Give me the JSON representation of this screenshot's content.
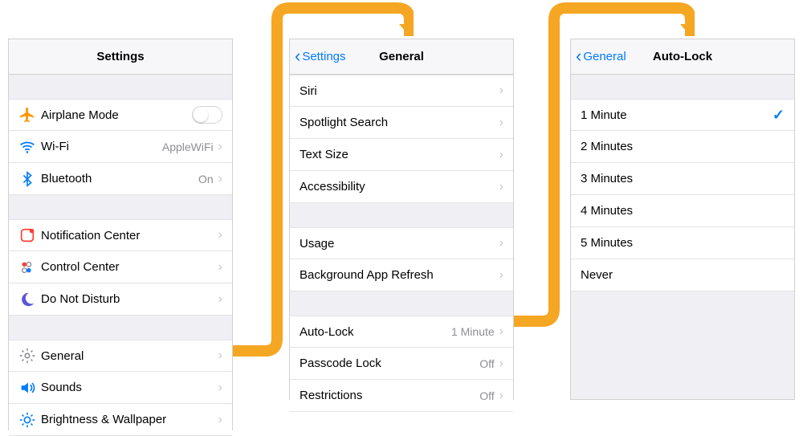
{
  "panel1": {
    "title": "Settings",
    "g1": [
      {
        "label": "Airplane Mode",
        "type": "toggle"
      },
      {
        "label": "Wi-Fi",
        "value": "AppleWiFi",
        "chevron": true
      },
      {
        "label": "Bluetooth",
        "value": "On",
        "chevron": true
      }
    ],
    "g2": [
      {
        "label": "Notification Center",
        "chevron": true
      },
      {
        "label": "Control Center",
        "chevron": true
      },
      {
        "label": "Do Not Disturb",
        "chevron": true
      }
    ],
    "g3": [
      {
        "label": "General",
        "chevron": true
      },
      {
        "label": "Sounds",
        "chevron": true
      },
      {
        "label": "Brightness & Wallpaper",
        "chevron": true
      }
    ]
  },
  "panel2": {
    "back": "Settings",
    "title": "General",
    "g1": [
      {
        "label": "Siri",
        "chevron": true
      },
      {
        "label": "Spotlight Search",
        "chevron": true
      },
      {
        "label": "Text Size",
        "chevron": true
      },
      {
        "label": "Accessibility",
        "chevron": true
      }
    ],
    "g2": [
      {
        "label": "Usage",
        "chevron": true
      },
      {
        "label": "Background App Refresh",
        "chevron": true
      }
    ],
    "g3": [
      {
        "label": "Auto-Lock",
        "value": "1 Minute",
        "chevron": true
      },
      {
        "label": "Passcode Lock",
        "value": "Off",
        "chevron": true
      },
      {
        "label": "Restrictions",
        "value": "Off",
        "chevron": true
      }
    ]
  },
  "panel3": {
    "back": "General",
    "title": "Auto-Lock",
    "options": [
      {
        "label": "1 Minute",
        "selected": true
      },
      {
        "label": "2 Minutes"
      },
      {
        "label": "3 Minutes"
      },
      {
        "label": "4 Minutes"
      },
      {
        "label": "5 Minutes"
      },
      {
        "label": "Never"
      }
    ]
  }
}
